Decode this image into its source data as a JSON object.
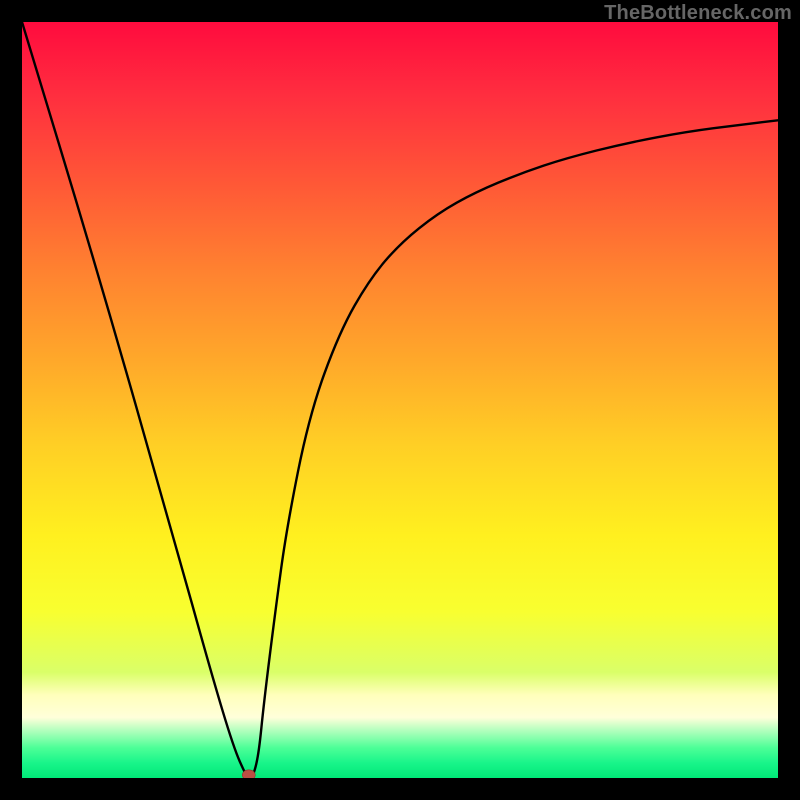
{
  "watermark": "TheBottleneck.com",
  "chart_data": {
    "type": "line",
    "title": "",
    "xlabel": "",
    "ylabel": "",
    "xlim": [
      0,
      100
    ],
    "ylim": [
      0,
      100
    ],
    "grid": false,
    "series": [
      {
        "name": "bottleneck-curve",
        "x": [
          0,
          10,
          20,
          25,
          28,
          29.6,
          30,
          30.5,
          31.3,
          32,
          33.5,
          35,
          38,
          42,
          46,
          50,
          55,
          60,
          66,
          72,
          80,
          88,
          95,
          100
        ],
        "values": [
          100,
          67,
          32,
          14,
          4,
          0.4,
          0,
          0,
          3,
          10,
          22,
          33,
          48,
          59,
          66,
          70.7,
          74.7,
          77.5,
          80,
          82,
          84,
          85.5,
          86.4,
          87
        ]
      }
    ],
    "marker": {
      "x": 30,
      "y": 0
    },
    "background_gradient": "heat-red-to-green",
    "colors": {
      "curve": "#000000",
      "marker": "#bb4f44",
      "frame": "#000000"
    }
  }
}
